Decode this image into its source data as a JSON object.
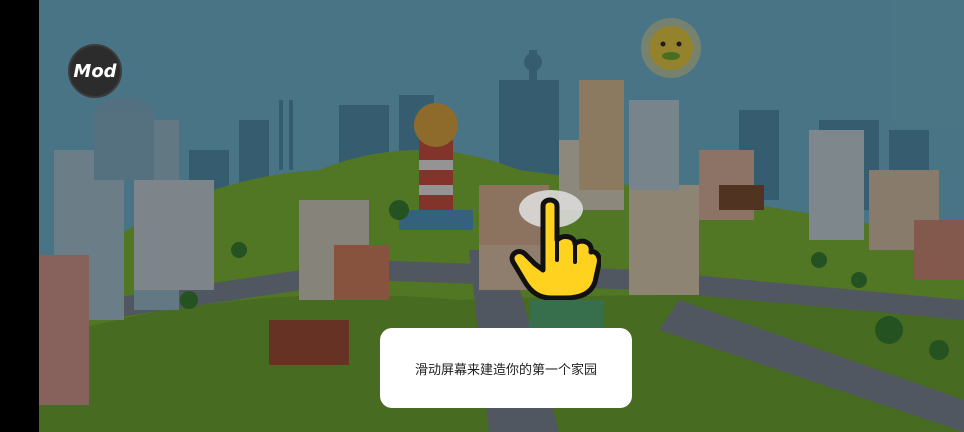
{
  "mod_badge": {
    "label": "Mod"
  },
  "tutorial": {
    "message": "滑动屏幕来建造你的第一个家园",
    "gesture_icon": "pointing-hand-icon"
  },
  "colors": {
    "sky": "#7fc9e6",
    "grass": "#8ccc3e",
    "road": "#8a96a6",
    "sun": "#ffe24d",
    "hand": "#ffd21f",
    "dialog": "#ffffff"
  }
}
